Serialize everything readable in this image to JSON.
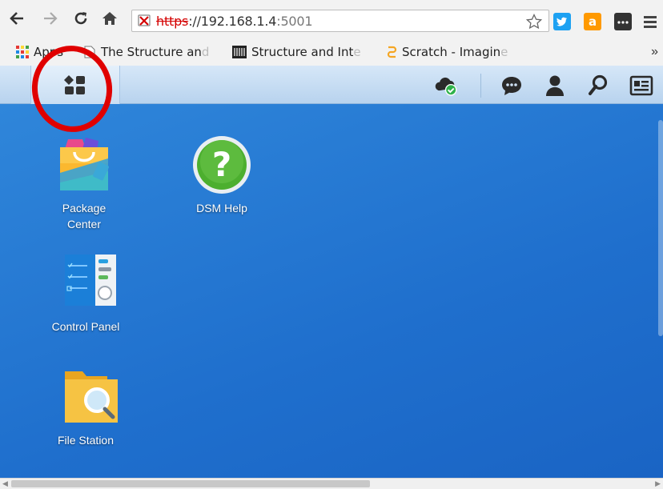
{
  "browser": {
    "url": {
      "scheme": "https",
      "host": "://192.168.1.4",
      "port": ":5001"
    },
    "extensions": [
      "twitter-extension-icon",
      "amazon-extension-icon",
      "more-extension-icon"
    ]
  },
  "bookmarks": {
    "apps_label": "Apps",
    "items": [
      {
        "label": "The Structure an",
        "fade": "d"
      },
      {
        "label": "Structure and Int",
        "fade": "e"
      },
      {
        "label": "Scratch - Imagin",
        "fade": "e"
      }
    ],
    "more": "»"
  },
  "dsm": {
    "desktop_shortcuts": [
      {
        "label": "Package Center"
      },
      {
        "label": "DSM Help"
      },
      {
        "label": "Control Panel"
      },
      {
        "label": "File Station"
      }
    ]
  },
  "colors": {
    "desktop": "#1f6fcd",
    "highlight": "#e00000",
    "help_green": "#4caf2f"
  }
}
